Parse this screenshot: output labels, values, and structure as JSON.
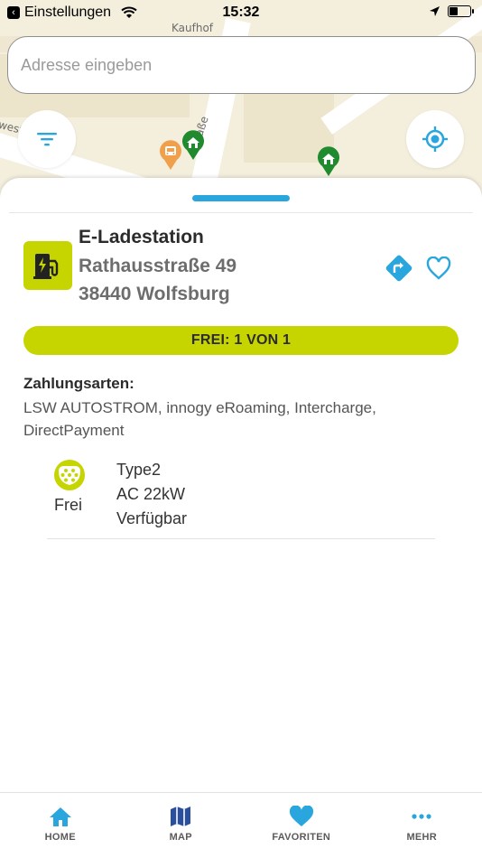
{
  "status_bar": {
    "back_app": "Einstellungen",
    "time": "15:32",
    "battery_level": 0.45
  },
  "map": {
    "street_labels": [
      "Kaufhof",
      "west",
      "rstraße"
    ]
  },
  "search": {
    "placeholder": "Adresse eingeben"
  },
  "station": {
    "type": "E-Ladestation",
    "street": "Rathausstraße 49",
    "city": "38440 Wolfsburg",
    "availability": "FREI: 1 VON 1",
    "payment_heading": "Zahlungsarten:",
    "payment_methods": "LSW AUTOSTROM, innogy eRoaming, Intercharge, DirectPayment",
    "connector": {
      "status": "Frei",
      "type": "Type2",
      "power": "AC 22kW",
      "state": "Verfügbar"
    }
  },
  "tabs": [
    {
      "label": "HOME",
      "icon": "home-icon"
    },
    {
      "label": "MAP",
      "icon": "map-icon"
    },
    {
      "label": "FAVORITEN",
      "icon": "heart-icon"
    },
    {
      "label": "MEHR",
      "icon": "more-icon"
    }
  ],
  "colors": {
    "accent_blue": "#2aa6df",
    "station_green": "#c6d400",
    "pin_green": "#1f8a2e",
    "pin_orange": "#f0a04a"
  }
}
